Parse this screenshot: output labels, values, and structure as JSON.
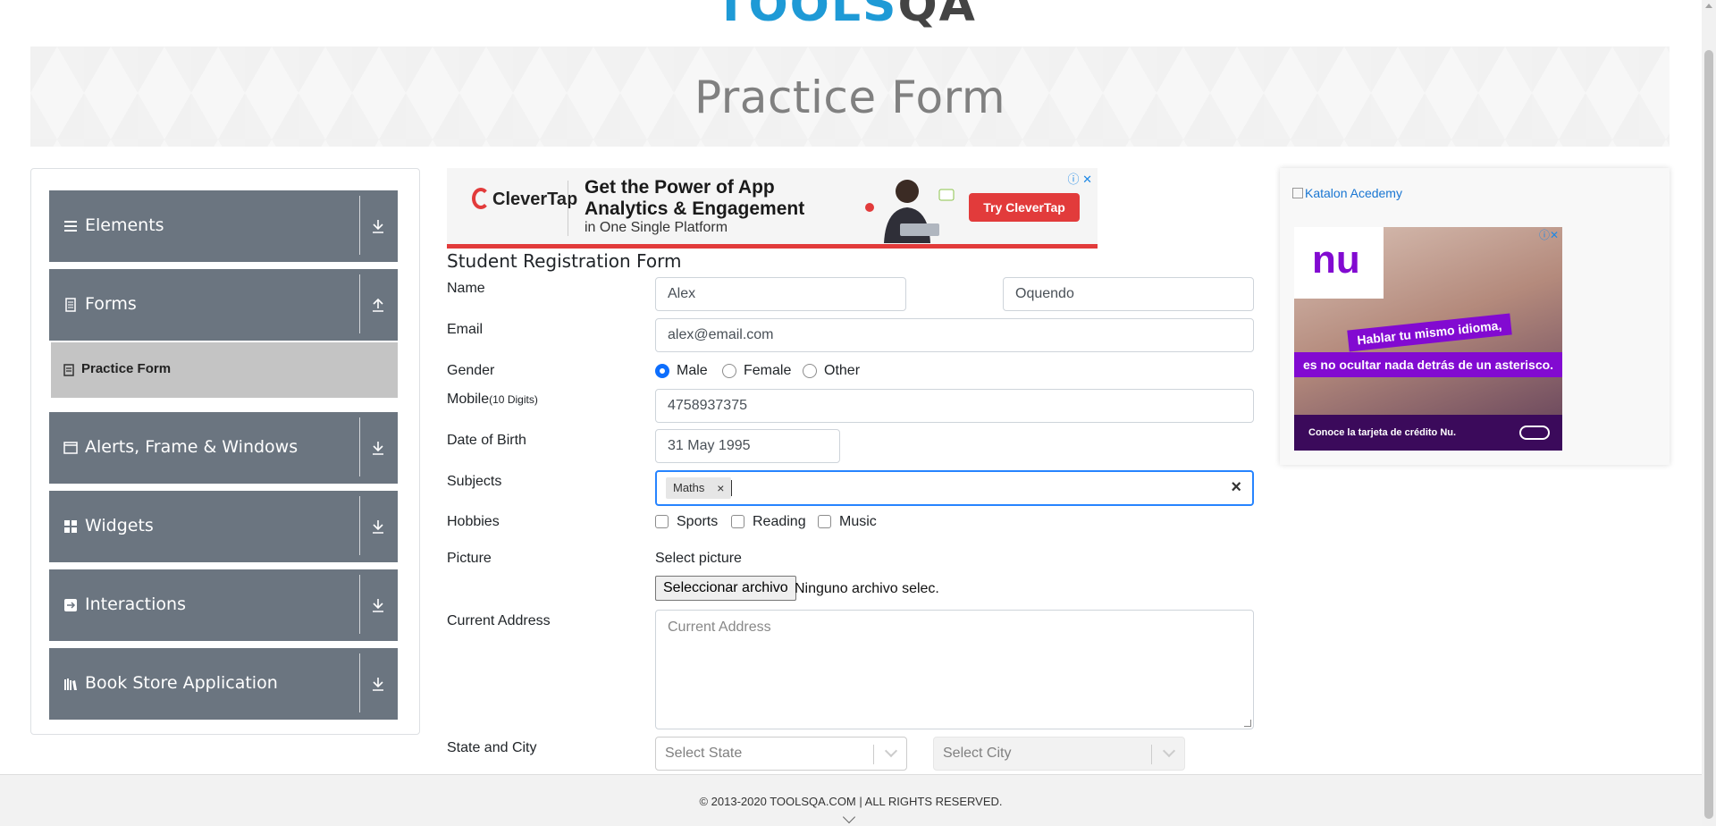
{
  "logo": {
    "part1": "TOOLS",
    "part2": "QA"
  },
  "page_title": "Practice Form",
  "sidebar": {
    "groups": [
      {
        "label": "Elements",
        "icon": "menu-icon",
        "arrow": "download-icon"
      },
      {
        "label": "Forms",
        "icon": "document-icon",
        "arrow": "upload-icon"
      },
      {
        "label": "Alerts, Frame & Windows",
        "icon": "window-icon",
        "arrow": "download-icon"
      },
      {
        "label": "Widgets",
        "icon": "grid-icon",
        "arrow": "download-icon"
      },
      {
        "label": "Interactions",
        "icon": "interaction-icon",
        "arrow": "download-icon"
      },
      {
        "label": "Book Store Application",
        "icon": "books-icon",
        "arrow": "download-icon"
      }
    ],
    "active_item": "Practice Form"
  },
  "ad_top": {
    "brand": "CleverTap",
    "headline_1": "Get the Power of App",
    "headline_2": "Analytics & Engagement",
    "sub": "in One Single Platform",
    "cta": "Try CleverTap",
    "adchoices": "ⓘ ✕",
    "accent": "#e23b3b"
  },
  "form": {
    "title": "Student Registration Form",
    "name_label": "Name",
    "first_name": "Alex",
    "last_name": "Oquendo",
    "email_label": "Email",
    "email": "alex@email.com",
    "gender_label": "Gender",
    "gender_options": [
      "Male",
      "Female",
      "Other"
    ],
    "gender_selected": "Male",
    "mobile_label": "Mobile",
    "mobile_hint": "(10 Digits)",
    "mobile": "4758937375",
    "dob_label": "Date of Birth",
    "dob": "31 May 1995",
    "subjects_label": "Subjects",
    "subjects": [
      "Maths"
    ],
    "hobbies_label": "Hobbies",
    "hobbies": [
      "Sports",
      "Reading",
      "Music"
    ],
    "picture_label": "Picture",
    "picture_note": "Select picture",
    "file_button": "Seleccionar archivo",
    "file_status": "Ninguno archivo selec.",
    "address_label": "Current Address",
    "address_placeholder": "Current Address",
    "state_city_label": "State and City",
    "state_placeholder": "Select State",
    "city_placeholder": "Select City"
  },
  "ad_right": {
    "link_text": "Katalon Acedemy",
    "brand": "nu",
    "line1": "Hablar tu mismo idioma,",
    "line2": "es no ocultar nada detrás de un asterisco.",
    "line3": "Conoce la tarjeta de crédito Nu.",
    "adchoices": "ⓘ✕",
    "brand_color": "#820ad1"
  },
  "footer": {
    "copyright": "© 2013-2020 TOOLSQA.COM | ALL RIGHTS RESERVED."
  }
}
